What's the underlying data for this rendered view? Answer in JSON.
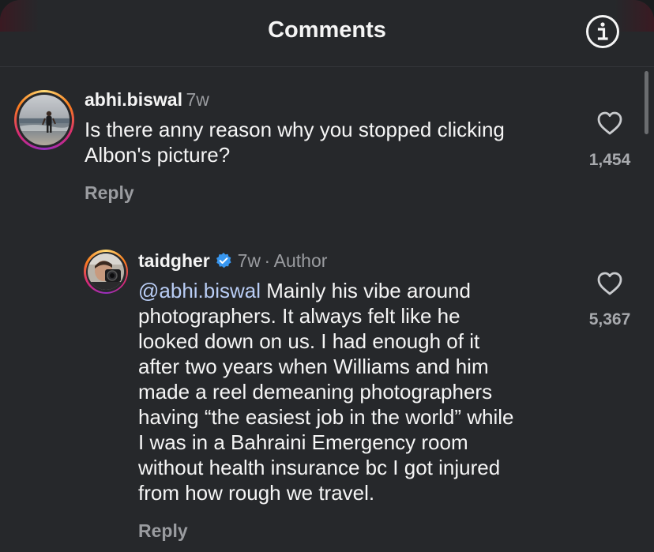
{
  "header": {
    "title": "Comments",
    "info_icon": "info-circle-icon"
  },
  "comments": [
    {
      "username": "abhi.biswal",
      "time": "7w",
      "text": [
        "Is there anny reason why you stopped clicking",
        "Albon's picture?"
      ],
      "reply_label": "Reply",
      "likes": "1,454",
      "like_icon": "heart-outline-icon"
    },
    {
      "username": "taidgher",
      "verified": true,
      "time": "7w",
      "separator": "·",
      "author_badge": "Author",
      "mention": "@abhi.biswal",
      "text_first": " Mainly his vibe around",
      "text": [
        "photographers. It always felt like he",
        "looked down on us. I had enough of it",
        "after two years when Williams and him",
        "made a reel demeaning photographers",
        "having “the easiest job in the world” while",
        "I was in a Bahraini Emergency room",
        "without health insurance bc I got injured",
        "from how rough we travel."
      ],
      "reply_label": "Reply",
      "likes": "5,367",
      "like_icon": "heart-outline-icon"
    }
  ],
  "colors": {
    "background": "#26282b",
    "mention": "#b9cdf5",
    "verified": "#3897f0",
    "secondary_text": "#9a9ca0"
  }
}
